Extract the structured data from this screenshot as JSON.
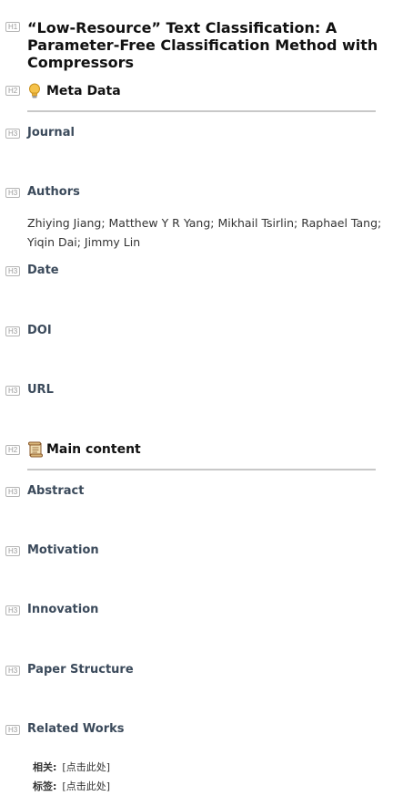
{
  "level_tags": {
    "h1": "H1",
    "h2": "H2",
    "h3": "H3"
  },
  "title": "“Low-Resource” Text Classification: A Parameter-Free Classification Method with Compressors",
  "meta_section": {
    "heading": "Meta Data",
    "icon": "lightbulb-icon",
    "fields": {
      "journal": "Journal",
      "authors": "Authors",
      "date": "Date",
      "doi": "DOI",
      "url": "URL"
    },
    "authors_value": "Zhiying Jiang; Matthew Y R Yang; Mikhail Tsirlin; Raphael Tang; Yiqin Dai; Jimmy Lin"
  },
  "main_section": {
    "heading": "Main content",
    "icon": "scroll-icon",
    "fields": {
      "abstract": "Abstract",
      "motivation": "Motivation",
      "innovation": "Innovation",
      "paper_structure": "Paper Structure",
      "related_works": "Related Works"
    }
  },
  "footer": {
    "related_key": "相关:",
    "related_value": "[点击此处]",
    "tags_key": "标签:",
    "tags_value": "[点击此处]"
  },
  "colors": {
    "heading3": "#3b4a5b",
    "rule": "#c8c8c8",
    "tag_border": "#b5b5b5"
  }
}
